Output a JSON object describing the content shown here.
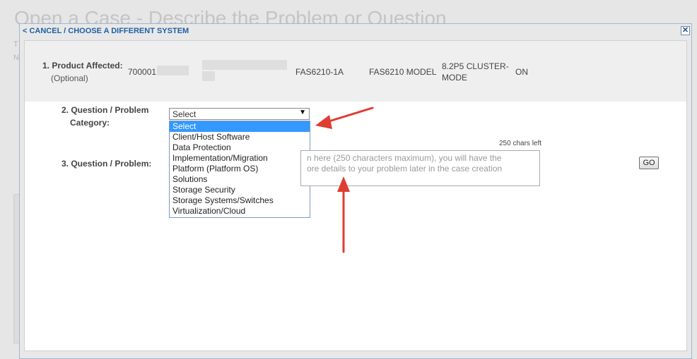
{
  "background": {
    "page_title": "Open a Case - Describe the Problem or Question",
    "side_letters": [
      "T",
      "N"
    ]
  },
  "modal": {
    "cancel_link": "< CANCEL / CHOOSE A DIFFERENT SYSTEM",
    "close_icon": "close-icon",
    "product": {
      "label": "1. Product Affected:",
      "optional": "(Optional)",
      "serial": "700001",
      "hostname": "FAS6210-1A",
      "model": "FAS6210 MODEL",
      "os_version": "8.2P5 CLUSTER-MODE",
      "status": "ON"
    },
    "category": {
      "label_line1": "2. Question / Problem",
      "label_line2": "Category:",
      "selected": "Select",
      "options": [
        "Select",
        "Client/Host Software",
        "Data Protection",
        "Implementation/Migration",
        "Platform (Platform OS)",
        "Solutions",
        "Storage Security",
        "Storage Systems/Switches",
        "Virtualization/Cloud"
      ],
      "highlighted_index": 0
    },
    "problem": {
      "label": "3. Question / Problem:",
      "chars_left": "250 chars left",
      "placeholder_line1": "n here (250 characters maximum), you will have the",
      "placeholder_line2": "ore details to your problem later in the case creation",
      "go_label": "GO"
    }
  },
  "colors": {
    "link": "#1f5fa3",
    "selection": "#3399ff",
    "annotation_arrow": "#e03c31"
  }
}
